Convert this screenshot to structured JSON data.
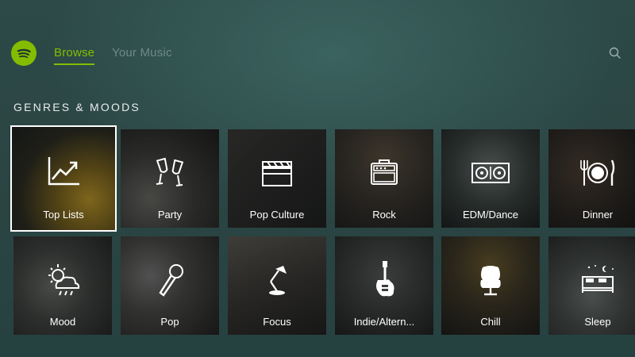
{
  "header": {
    "tabs": [
      {
        "label": "Browse",
        "active": true
      },
      {
        "label": "Your Music",
        "active": false
      }
    ],
    "icons": {
      "logo": "spotify-logo",
      "search": "search-icon"
    }
  },
  "section": {
    "title": "GENRES & MOODS"
  },
  "tiles": [
    {
      "label": "Top Lists",
      "icon": "trending-up-icon",
      "selected": true
    },
    {
      "label": "Party",
      "icon": "champagne-glasses-icon"
    },
    {
      "label": "Pop Culture",
      "icon": "clapperboard-icon"
    },
    {
      "label": "Rock",
      "icon": "amplifier-icon"
    },
    {
      "label": "EDM/Dance",
      "icon": "turntables-icon"
    },
    {
      "label": "Dinner",
      "icon": "fork-plate-knife-icon"
    },
    {
      "label": "Mood",
      "icon": "weather-icon"
    },
    {
      "label": "Pop",
      "icon": "microphone-icon"
    },
    {
      "label": "Focus",
      "icon": "desk-lamp-icon"
    },
    {
      "label": "Indie/Altern...",
      "icon": "electric-guitar-icon"
    },
    {
      "label": "Chill",
      "icon": "lounge-chair-icon"
    },
    {
      "label": "Sleep",
      "icon": "bed-icon"
    }
  ],
  "colors": {
    "accent": "#84bd00",
    "inactive": "#6f8a87",
    "background": "#2b4543"
  }
}
